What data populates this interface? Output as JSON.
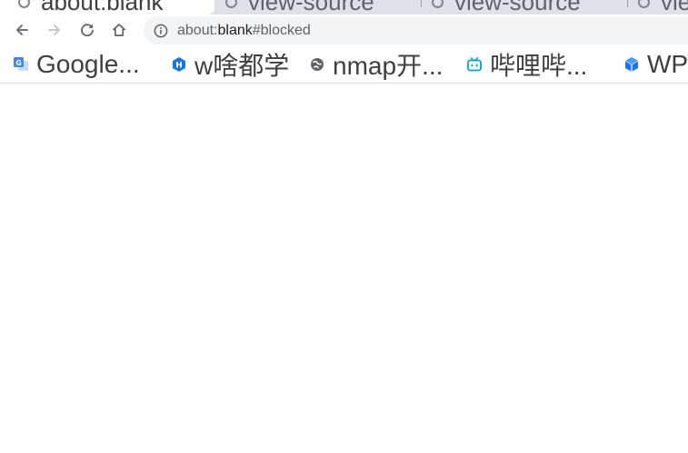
{
  "tabs": [
    {
      "label": "about:blank",
      "active": true
    },
    {
      "label": "view-source",
      "active": false
    },
    {
      "label": "view-source",
      "active": false
    },
    {
      "label": "vie",
      "active": false
    }
  ],
  "toolbar": {
    "back_icon": "arrow-left-icon",
    "forward_icon": "arrow-right-icon",
    "reload_icon": "reload-icon",
    "home_icon": "home-icon"
  },
  "omnibox": {
    "scheme": "about:",
    "host": "blank",
    "fragment": "#blocked",
    "icon": "info-icon"
  },
  "bookmarks": [
    {
      "label": "Google...",
      "icon": "google-translate-icon"
    },
    {
      "label": "w啥都学",
      "icon": "hexagon-h-icon"
    },
    {
      "label": "nmap开...",
      "icon": "globe-icon"
    },
    {
      "label": "哔哩哔...",
      "icon": "bilibili-tv-icon"
    },
    {
      "label": "WP",
      "icon": "cube-icon"
    }
  ],
  "colors": {
    "tabstrip_bg": "#dee1e6",
    "omnibox_bg": "#f1f3f4",
    "icon_gray": "#5f6368",
    "accent_blue": "#1a73e8",
    "bilibili_blue": "#00a1d6"
  }
}
